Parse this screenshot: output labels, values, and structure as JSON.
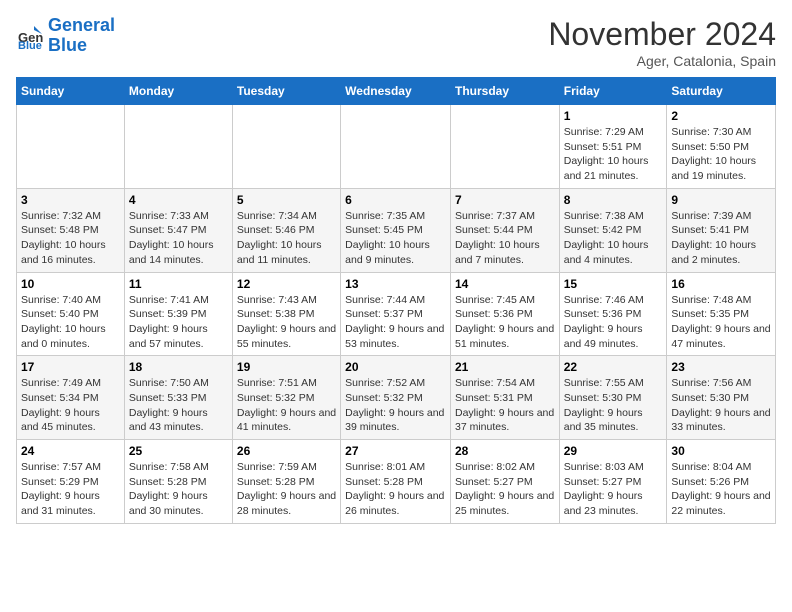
{
  "logo": {
    "text_general": "General",
    "text_blue": "Blue"
  },
  "header": {
    "month": "November 2024",
    "location": "Ager, Catalonia, Spain"
  },
  "days_of_week": [
    "Sunday",
    "Monday",
    "Tuesday",
    "Wednesday",
    "Thursday",
    "Friday",
    "Saturday"
  ],
  "weeks": [
    [
      {
        "day": "",
        "info": ""
      },
      {
        "day": "",
        "info": ""
      },
      {
        "day": "",
        "info": ""
      },
      {
        "day": "",
        "info": ""
      },
      {
        "day": "",
        "info": ""
      },
      {
        "day": "1",
        "info": "Sunrise: 7:29 AM\nSunset: 5:51 PM\nDaylight: 10 hours and 21 minutes."
      },
      {
        "day": "2",
        "info": "Sunrise: 7:30 AM\nSunset: 5:50 PM\nDaylight: 10 hours and 19 minutes."
      }
    ],
    [
      {
        "day": "3",
        "info": "Sunrise: 7:32 AM\nSunset: 5:48 PM\nDaylight: 10 hours and 16 minutes."
      },
      {
        "day": "4",
        "info": "Sunrise: 7:33 AM\nSunset: 5:47 PM\nDaylight: 10 hours and 14 minutes."
      },
      {
        "day": "5",
        "info": "Sunrise: 7:34 AM\nSunset: 5:46 PM\nDaylight: 10 hours and 11 minutes."
      },
      {
        "day": "6",
        "info": "Sunrise: 7:35 AM\nSunset: 5:45 PM\nDaylight: 10 hours and 9 minutes."
      },
      {
        "day": "7",
        "info": "Sunrise: 7:37 AM\nSunset: 5:44 PM\nDaylight: 10 hours and 7 minutes."
      },
      {
        "day": "8",
        "info": "Sunrise: 7:38 AM\nSunset: 5:42 PM\nDaylight: 10 hours and 4 minutes."
      },
      {
        "day": "9",
        "info": "Sunrise: 7:39 AM\nSunset: 5:41 PM\nDaylight: 10 hours and 2 minutes."
      }
    ],
    [
      {
        "day": "10",
        "info": "Sunrise: 7:40 AM\nSunset: 5:40 PM\nDaylight: 10 hours and 0 minutes."
      },
      {
        "day": "11",
        "info": "Sunrise: 7:41 AM\nSunset: 5:39 PM\nDaylight: 9 hours and 57 minutes."
      },
      {
        "day": "12",
        "info": "Sunrise: 7:43 AM\nSunset: 5:38 PM\nDaylight: 9 hours and 55 minutes."
      },
      {
        "day": "13",
        "info": "Sunrise: 7:44 AM\nSunset: 5:37 PM\nDaylight: 9 hours and 53 minutes."
      },
      {
        "day": "14",
        "info": "Sunrise: 7:45 AM\nSunset: 5:36 PM\nDaylight: 9 hours and 51 minutes."
      },
      {
        "day": "15",
        "info": "Sunrise: 7:46 AM\nSunset: 5:36 PM\nDaylight: 9 hours and 49 minutes."
      },
      {
        "day": "16",
        "info": "Sunrise: 7:48 AM\nSunset: 5:35 PM\nDaylight: 9 hours and 47 minutes."
      }
    ],
    [
      {
        "day": "17",
        "info": "Sunrise: 7:49 AM\nSunset: 5:34 PM\nDaylight: 9 hours and 45 minutes."
      },
      {
        "day": "18",
        "info": "Sunrise: 7:50 AM\nSunset: 5:33 PM\nDaylight: 9 hours and 43 minutes."
      },
      {
        "day": "19",
        "info": "Sunrise: 7:51 AM\nSunset: 5:32 PM\nDaylight: 9 hours and 41 minutes."
      },
      {
        "day": "20",
        "info": "Sunrise: 7:52 AM\nSunset: 5:32 PM\nDaylight: 9 hours and 39 minutes."
      },
      {
        "day": "21",
        "info": "Sunrise: 7:54 AM\nSunset: 5:31 PM\nDaylight: 9 hours and 37 minutes."
      },
      {
        "day": "22",
        "info": "Sunrise: 7:55 AM\nSunset: 5:30 PM\nDaylight: 9 hours and 35 minutes."
      },
      {
        "day": "23",
        "info": "Sunrise: 7:56 AM\nSunset: 5:30 PM\nDaylight: 9 hours and 33 minutes."
      }
    ],
    [
      {
        "day": "24",
        "info": "Sunrise: 7:57 AM\nSunset: 5:29 PM\nDaylight: 9 hours and 31 minutes."
      },
      {
        "day": "25",
        "info": "Sunrise: 7:58 AM\nSunset: 5:28 PM\nDaylight: 9 hours and 30 minutes."
      },
      {
        "day": "26",
        "info": "Sunrise: 7:59 AM\nSunset: 5:28 PM\nDaylight: 9 hours and 28 minutes."
      },
      {
        "day": "27",
        "info": "Sunrise: 8:01 AM\nSunset: 5:28 PM\nDaylight: 9 hours and 26 minutes."
      },
      {
        "day": "28",
        "info": "Sunrise: 8:02 AM\nSunset: 5:27 PM\nDaylight: 9 hours and 25 minutes."
      },
      {
        "day": "29",
        "info": "Sunrise: 8:03 AM\nSunset: 5:27 PM\nDaylight: 9 hours and 23 minutes."
      },
      {
        "day": "30",
        "info": "Sunrise: 8:04 AM\nSunset: 5:26 PM\nDaylight: 9 hours and 22 minutes."
      }
    ]
  ]
}
